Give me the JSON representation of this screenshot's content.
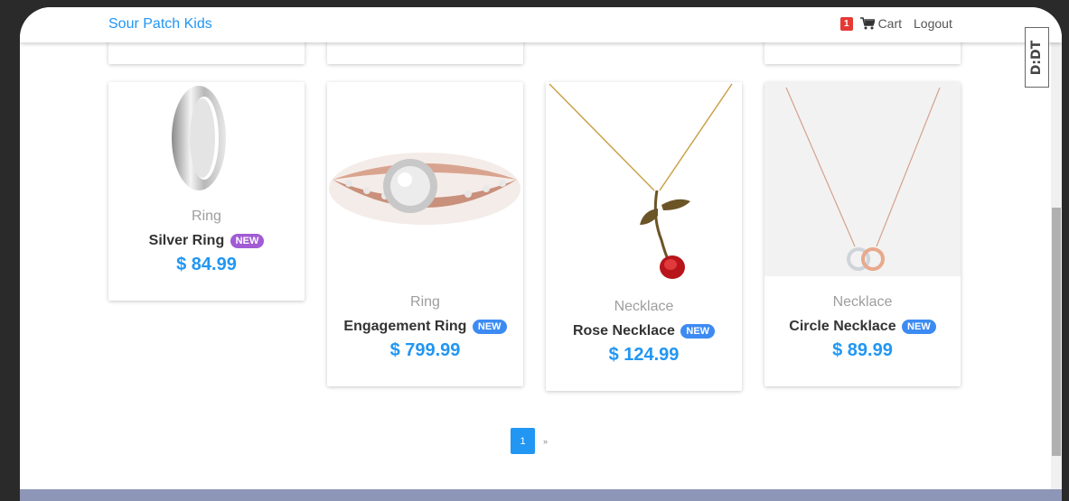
{
  "navbar": {
    "brand": "Sour Patch Kids",
    "cart_count": "1",
    "cart_label": "Cart",
    "logout_label": "Logout"
  },
  "products": [
    {
      "category": "Ring",
      "name": "Silver Ring",
      "badge": "NEW",
      "price": "$ 84.99",
      "badge_color": "#a15bd4"
    },
    {
      "category": "Ring",
      "name": "Engagement Ring",
      "badge": "NEW",
      "price": "$ 799.99",
      "badge_color": "#3d8bf2"
    },
    {
      "category": "Necklace",
      "name": "Rose Necklace",
      "badge": "NEW",
      "price": "$ 124.99",
      "badge_color": "#3d8bf2"
    },
    {
      "category": "Necklace",
      "name": "Circle Necklace",
      "badge": "NEW",
      "price": "$ 89.99",
      "badge_color": "#3d8bf2"
    }
  ],
  "pagination": {
    "current_page": "1",
    "next_label": "»"
  },
  "extension_badge": "D:DT",
  "colors": {
    "accent": "#2196f3",
    "cart_badge": "#e53935",
    "footer": "#8d96b7"
  }
}
